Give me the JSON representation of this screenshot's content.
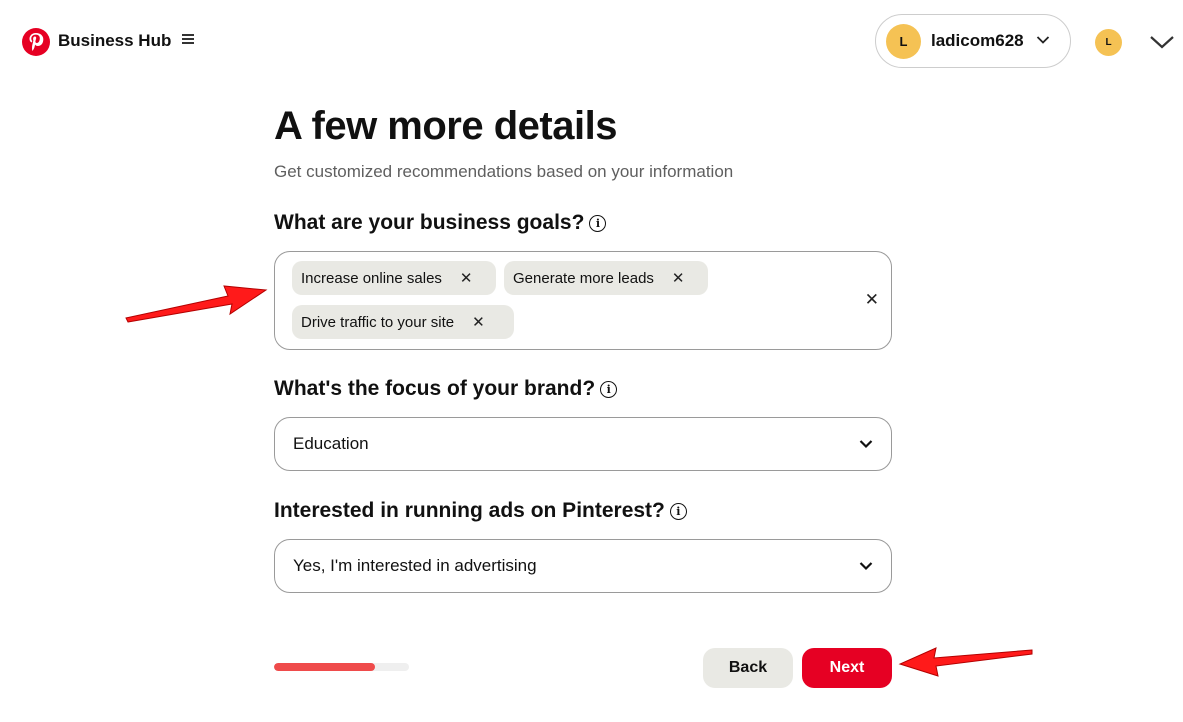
{
  "header": {
    "brand": "Business Hub",
    "account": {
      "initial": "L",
      "name": "ladicom628"
    },
    "avatar_initial": "L"
  },
  "page": {
    "title": "A few more details",
    "subtitle": "Get customized recommendations based on your information"
  },
  "goals": {
    "question": "What are your business goals?",
    "selected": [
      "Increase online sales",
      "Generate more leads",
      "Drive traffic to your site"
    ]
  },
  "brand_focus": {
    "question": "What's the focus of your brand?",
    "value": "Education"
  },
  "ads": {
    "question": "Interested in running ads on Pinterest?",
    "value": "Yes, I'm interested in advertising"
  },
  "progress": {
    "fraction": 0.75
  },
  "buttons": {
    "back": "Back",
    "next": "Next"
  },
  "colors": {
    "brand": "#e60023",
    "progress": "#ef4b4b",
    "annotation_arrow": "#ff1a1a",
    "avatar": "#f5c254"
  },
  "icons": [
    "pinterest-logo",
    "menu-icon",
    "chevron-down-icon",
    "info-icon",
    "close-icon",
    "annotation-arrow"
  ]
}
